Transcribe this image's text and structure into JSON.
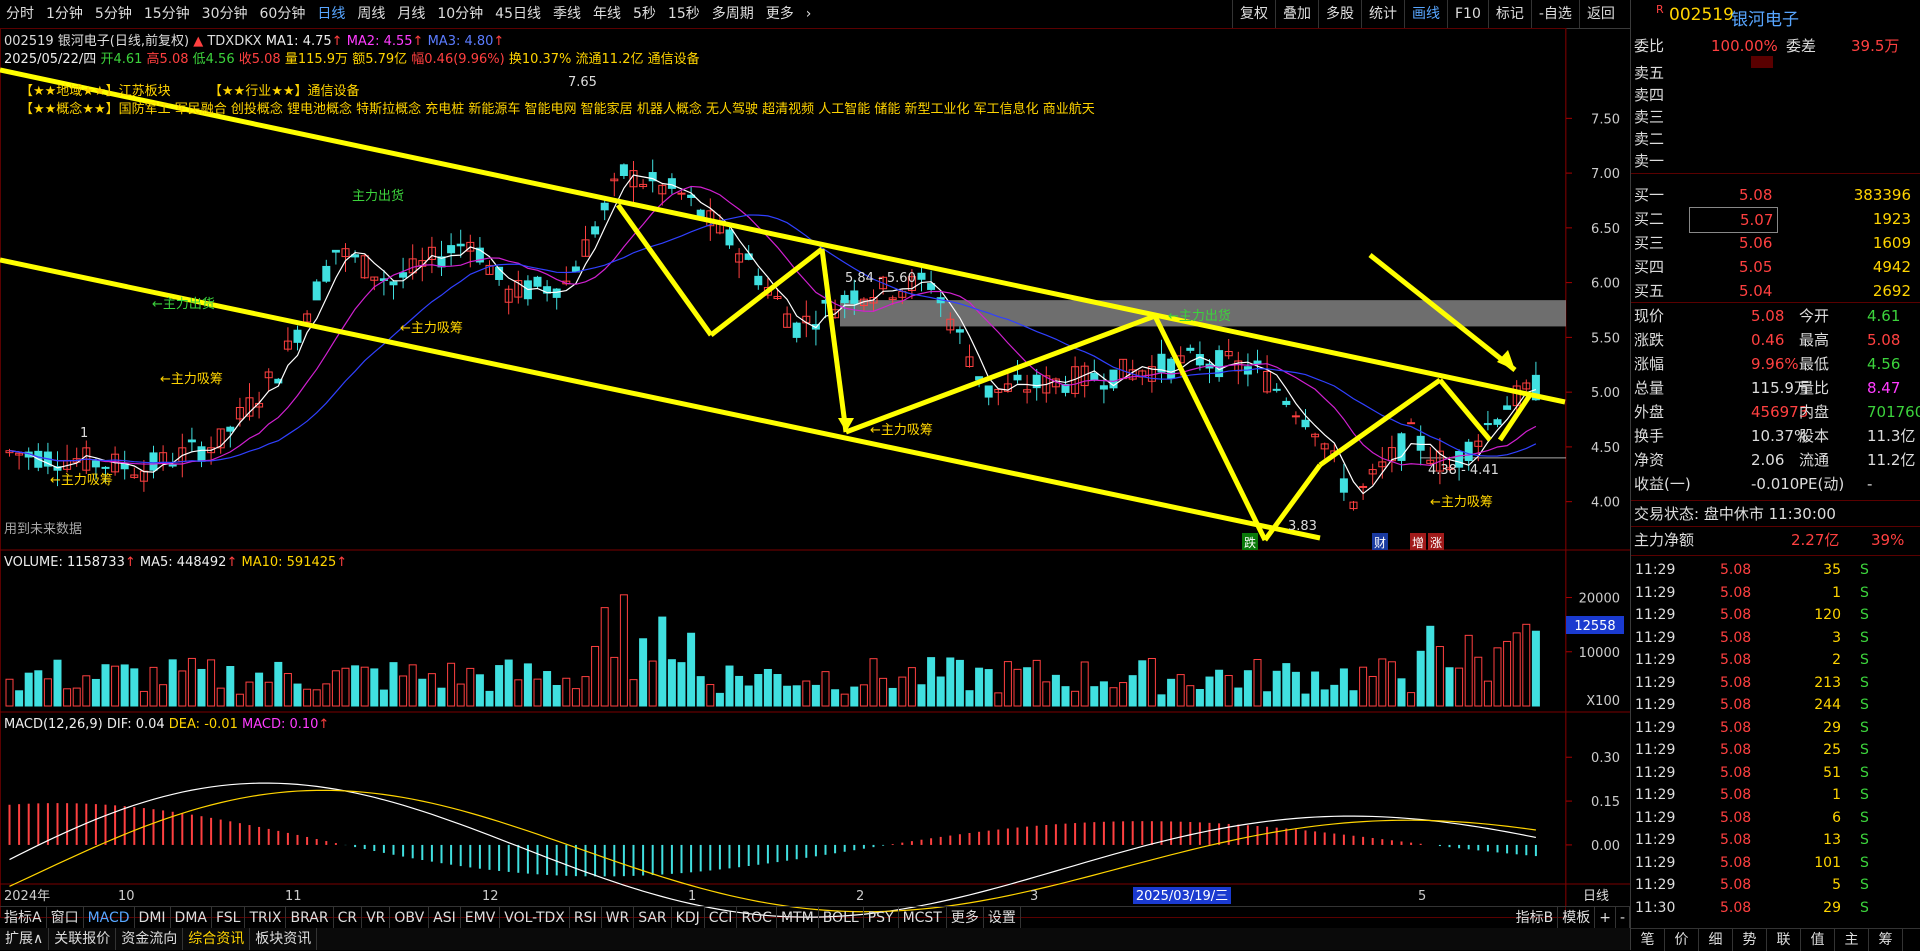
{
  "top_menu": {
    "periods": [
      "分时",
      "1分钟",
      "5分钟",
      "15分钟",
      "30分钟",
      "60分钟",
      "日线",
      "周线",
      "月线",
      "10分钟",
      "45日线",
      "季线",
      "年线",
      "5秒",
      "15秒",
      "多周期",
      "更多"
    ],
    "selected": "日线",
    "more_arrow": "›"
  },
  "toolbar": {
    "items": [
      "复权",
      "叠加",
      "多股",
      "统计",
      "画线",
      "F10",
      "标记",
      "-自选",
      "返回"
    ],
    "selected": "画线"
  },
  "header": {
    "code": "002519",
    "name_mode": "银河电子(日线,前复权)",
    "indicator": "TDXDKX",
    "ma1": "MA1: 4.75",
    "ma2": "MA2: 4.55",
    "ma3": "MA3: 4.80"
  },
  "info": {
    "date": "2025/05/22/四",
    "open": "开4.61",
    "high": "高5.08",
    "low": "低4.56",
    "close": "收5.08",
    "volume": "量115.9万",
    "amount": "额5.79亿",
    "change": "幅0.46(9.96%)",
    "turnover": "换10.37%",
    "float": "流通11.2亿",
    "sector": "通信设备"
  },
  "concepts": {
    "region": "【★★地域★★】江苏板块",
    "industry": "【★★行业★★】通信设备",
    "concept_label": "【★★概念★★】",
    "concept_list": "国防军工 军民融合 创投概念 锂电池概念 特斯拉概念 充电桩 新能源车 智能电网 智能家居 机器人概念 无人驾驶 超清视频 人工智能 储能 新型工业化 军工信息化 商业航天"
  },
  "annotations": {
    "future_note": "用到未来数据",
    "main_out_1": "主力出货",
    "main_out_2": "←主力出货",
    "main_buy": "←主力吸筹",
    "main_buy_2": "主力吸筹",
    "box_range": "5.84 - 5.60",
    "low_range": "4.38 - 4.41",
    "peak": "7.65",
    "low_price": "3.83",
    "drop_badge": "跌",
    "fin_badge": "财",
    "inc_badge": "增",
    "up_badge": "涨",
    "one": "1"
  },
  "price_axis": [
    "7.50",
    "7.00",
    "6.50",
    "6.00",
    "5.50",
    "5.00",
    "4.50",
    "4.00"
  ],
  "vol_axis": [
    "20000",
    "10000",
    "X100"
  ],
  "vol_marker": "12558",
  "macd_axis": [
    "0.30",
    "0.15",
    "0.00"
  ],
  "volume_hdr": {
    "label": "VOLUME: 1158733",
    "ma5": "MA5: 448492",
    "ma10": "MA10: 591425"
  },
  "macd_hdr": {
    "label": "MACD(12,26,9)",
    "dif": "DIF: 0.04",
    "dea": "DEA: -0.01",
    "macd": "MACD: 0.10"
  },
  "x_axis": {
    "labels": [
      "2024年",
      "10",
      "11",
      "12",
      "1",
      "2",
      "3",
      "5"
    ],
    "date_marker": "2025/03/19/三",
    "period": "日线"
  },
  "bottom_tabs": [
    "指标A",
    "窗口",
    "MACD",
    "DMI",
    "DMA",
    "FSL",
    "TRIX",
    "BRAR",
    "CR",
    "VR",
    "OBV",
    "ASI",
    "EMV",
    "VOL-TDX",
    "RSI",
    "WR",
    "SAR",
    "KDJ",
    "CCI",
    "ROC",
    "MTM",
    "BOLL",
    "PSY",
    "MCST",
    "更多",
    "设置"
  ],
  "bottom_tabs_right": [
    "指标B",
    "模板",
    "+",
    "-"
  ],
  "bottom_tabs2": [
    "扩展∧",
    "关联报价",
    "资金流向",
    "综合资讯",
    "板块资讯"
  ],
  "panel": {
    "badge": "R",
    "code": "002519",
    "name": "银河电子",
    "weibi_label": "委比",
    "weibi": "100.00%",
    "weicha_label": "委差",
    "weicha": "39.5万",
    "sells": [
      {
        "l": "卖五"
      },
      {
        "l": "卖四"
      },
      {
        "l": "卖三"
      },
      {
        "l": "卖二"
      },
      {
        "l": "卖一"
      }
    ],
    "buys": [
      {
        "l": "买一",
        "p": "5.08",
        "v": "383396"
      },
      {
        "l": "买二",
        "p": "5.07",
        "v": "1923"
      },
      {
        "l": "买三",
        "p": "5.06",
        "v": "1609"
      },
      {
        "l": "买四",
        "p": "5.05",
        "v": "4942"
      },
      {
        "l": "买五",
        "p": "5.04",
        "v": "2692"
      }
    ],
    "stats": [
      {
        "l1": "现价",
        "v1": "5.08",
        "l2": "今开",
        "v2": "4.61"
      },
      {
        "l1": "涨跌",
        "v1": "0.46",
        "l2": "最高",
        "v2": "5.08"
      },
      {
        "l1": "涨幅",
        "v1": "9.96%",
        "l2": "最低",
        "v2": "4.56"
      },
      {
        "l1": "总量",
        "v1": "115.9万",
        "l2": "量比",
        "v2": "8.47"
      },
      {
        "l1": "外盘",
        "v1": "456973",
        "l2": "内盘",
        "v2": "701760"
      },
      {
        "l1": "换手",
        "v1": "10.37%",
        "l2": "股本",
        "v2": "11.3亿"
      },
      {
        "l1": "净资",
        "v1": "2.06",
        "l2": "流通",
        "v2": "11.2亿"
      },
      {
        "l1": "收益(一)",
        "v1": "-0.010",
        "l2": "PE(动)",
        "v2": "-"
      }
    ],
    "trade_state": "交易状态: 盘中休市 11:30:00",
    "net_label": "主力净额",
    "net_value": "2.27亿",
    "net_pct": "39%",
    "ticks": [
      {
        "t": "11:29",
        "p": "5.08",
        "v": "35",
        "s": "S"
      },
      {
        "t": "11:29",
        "p": "5.08",
        "v": "1",
        "s": "S"
      },
      {
        "t": "11:29",
        "p": "5.08",
        "v": "120",
        "s": "S"
      },
      {
        "t": "11:29",
        "p": "5.08",
        "v": "3",
        "s": "S"
      },
      {
        "t": "11:29",
        "p": "5.08",
        "v": "2",
        "s": "S"
      },
      {
        "t": "11:29",
        "p": "5.08",
        "v": "213",
        "s": "S"
      },
      {
        "t": "11:29",
        "p": "5.08",
        "v": "244",
        "s": "S"
      },
      {
        "t": "11:29",
        "p": "5.08",
        "v": "29",
        "s": "S"
      },
      {
        "t": "11:29",
        "p": "5.08",
        "v": "25",
        "s": "S"
      },
      {
        "t": "11:29",
        "p": "5.08",
        "v": "51",
        "s": "S"
      },
      {
        "t": "11:29",
        "p": "5.08",
        "v": "1",
        "s": "S"
      },
      {
        "t": "11:29",
        "p": "5.08",
        "v": "6",
        "s": "S"
      },
      {
        "t": "11:29",
        "p": "5.08",
        "v": "13",
        "s": "S"
      },
      {
        "t": "11:29",
        "p": "5.08",
        "v": "101",
        "s": "S"
      },
      {
        "t": "11:29",
        "p": "5.08",
        "v": "5",
        "s": "S"
      },
      {
        "t": "11:30",
        "p": "5.08",
        "v": "29",
        "s": "S"
      }
    ],
    "tabs": [
      "笔",
      "价",
      "细",
      "势",
      "联",
      "值",
      "主",
      "筹"
    ]
  },
  "colors": {
    "up": "#ff4040",
    "down": "#40e0e0",
    "trend": "#ffff00",
    "accent": "#58a6ff"
  }
}
